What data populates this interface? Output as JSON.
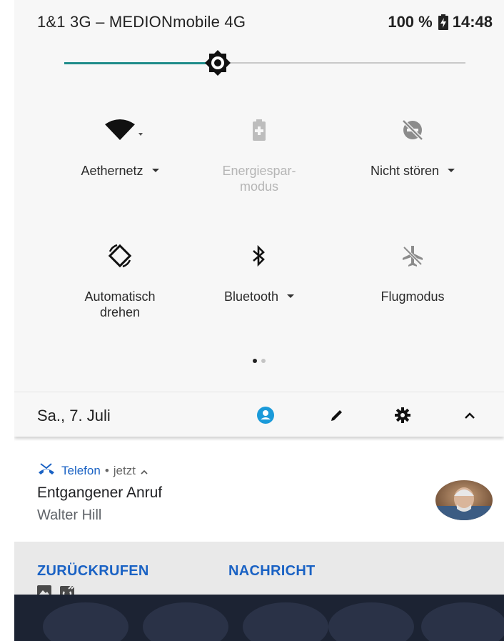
{
  "status_bar": {
    "carrier": "1&1 3G – MEDIONmobile 4G",
    "battery": "100 %",
    "time": "14:48"
  },
  "brightness": {
    "level_fraction": 0.38
  },
  "tiles": [
    {
      "label": "Aethernetz",
      "icon": "wifi-icon",
      "has_dropdown": true
    },
    {
      "label": "Energiespar-",
      "label2": "modus",
      "icon": "battery-saver-icon",
      "disabled": true
    },
    {
      "label": "Nicht stören",
      "icon": "do-not-disturb-icon",
      "has_dropdown": true
    },
    {
      "label": "Automatisch",
      "label2": "drehen",
      "icon": "auto-rotate-icon"
    },
    {
      "label": "Bluetooth",
      "icon": "bluetooth-icon",
      "has_dropdown": true
    },
    {
      "label": "Flugmodus",
      "icon": "airplane-mode-icon"
    }
  ],
  "pager": {
    "pages": 2,
    "current": 1
  },
  "date_bar": {
    "date": "Sa., 7. Juli",
    "icons": [
      "user-account-icon",
      "edit-icon",
      "settings-gear-icon",
      "collapse-chevron-icon"
    ]
  },
  "notification": {
    "app_name": "Telefon",
    "separator": "•",
    "time": "jetzt",
    "title": "Entgangener Anruf",
    "caller": "Walter Hill",
    "actions": [
      "ZURÜCKRUFEN",
      "NACHRICHT"
    ]
  },
  "colors": {
    "accent": "#1e8c8a",
    "link_blue": "#1a62c4",
    "user_icon": "#1a9ad9",
    "panel_bg": "#f7f7f7"
  }
}
